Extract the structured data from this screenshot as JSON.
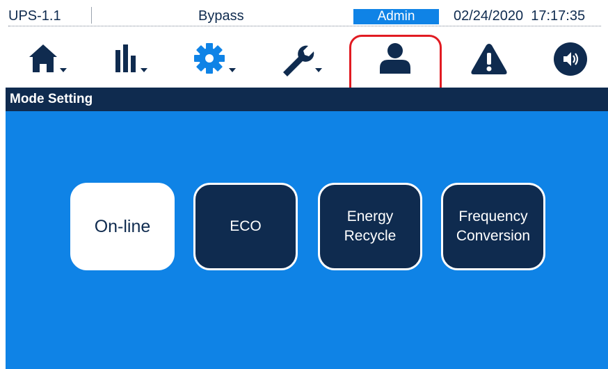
{
  "status_bar": {
    "device_id": "UPS-1.1",
    "ups_status": "Bypass",
    "user_level": "Admin",
    "date": "02/24/2020",
    "time": "17:17:35"
  },
  "toolbar": {
    "items": [
      {
        "name": "home",
        "icon": "home-icon",
        "has_dropdown": true
      },
      {
        "name": "measurements",
        "icon": "bar-chart-icon",
        "has_dropdown": true
      },
      {
        "name": "settings",
        "icon": "gear-icon",
        "has_dropdown": true
      },
      {
        "name": "maintenance",
        "icon": "wrench-icon",
        "has_dropdown": true
      },
      {
        "name": "user",
        "icon": "user-icon",
        "has_dropdown": false,
        "selected": true
      },
      {
        "name": "alarm",
        "icon": "warning-icon",
        "has_dropdown": false
      },
      {
        "name": "sound",
        "icon": "speaker-icon",
        "has_dropdown": false
      }
    ],
    "highlight_color": "#e11b22"
  },
  "section": {
    "title": "Mode Setting"
  },
  "modes": {
    "options": [
      {
        "label": "On-line",
        "active": true
      },
      {
        "label": "ECO",
        "active": false
      },
      {
        "label": "Energy\nRecycle",
        "active": false
      },
      {
        "label": "Frequency\nConversion",
        "active": false
      }
    ]
  },
  "colors": {
    "navy": "#0f2b4f",
    "panel_blue": "#0f83e6",
    "badge_blue": "#0f83e6",
    "white": "#ffffff"
  }
}
